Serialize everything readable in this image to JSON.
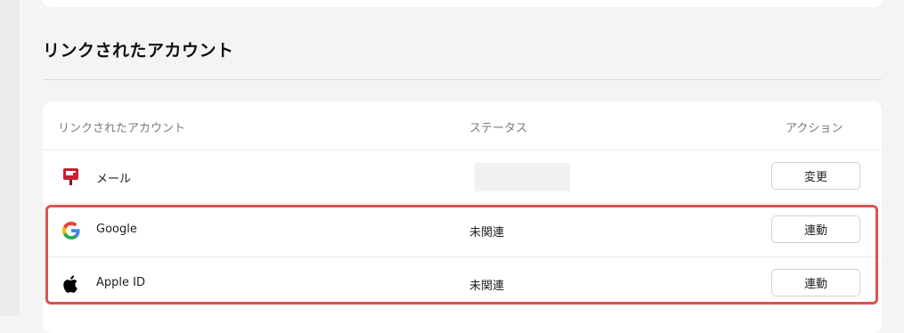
{
  "section": {
    "title": "リンクされたアカウント"
  },
  "table": {
    "headers": {
      "account": "リンクされたアカウント",
      "status": "ステータス",
      "action": "アクション"
    },
    "rows": [
      {
        "label": "メール",
        "icon": "mailbox-icon",
        "status": "",
        "button_label": "変更"
      },
      {
        "label": "Google",
        "icon": "google-icon",
        "status": "未関連",
        "button_label": "連動"
      },
      {
        "label": "Apple ID",
        "icon": "apple-icon",
        "status": "未関連",
        "button_label": "連動"
      }
    ]
  },
  "colors": {
    "highlight": "#d9534f",
    "mail_icon": "#c8202f"
  }
}
